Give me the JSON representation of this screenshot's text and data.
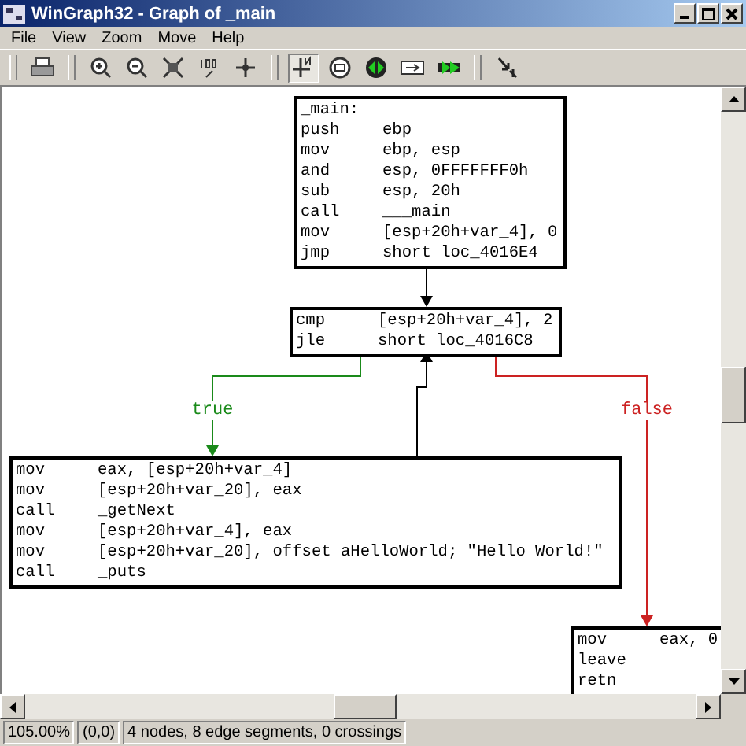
{
  "window": {
    "title": "WinGraph32 - Graph of _main"
  },
  "menu": [
    "File",
    "View",
    "Zoom",
    "Move",
    "Help"
  ],
  "toolbar": [
    {
      "kind": "print"
    },
    {
      "kind": "sep"
    },
    {
      "kind": "zoom-in"
    },
    {
      "kind": "zoom-out"
    },
    {
      "kind": "fit"
    },
    {
      "kind": "hundred"
    },
    {
      "kind": "move"
    },
    {
      "kind": "sep"
    },
    {
      "kind": "north",
      "selected": true
    },
    {
      "kind": "circle"
    },
    {
      "kind": "node-green"
    },
    {
      "kind": "edge"
    },
    {
      "kind": "edge-green"
    },
    {
      "kind": "sep"
    },
    {
      "kind": "pointer"
    }
  ],
  "nodes": [
    {
      "lines": [
        {
          "kind": "label",
          "text": "_main:"
        },
        {
          "kind": "ins",
          "op": "push",
          "args": "ebp"
        },
        {
          "kind": "ins",
          "op": "mov",
          "args": "ebp, esp"
        },
        {
          "kind": "ins",
          "op": "and",
          "args": "esp, 0FFFFFFF0h"
        },
        {
          "kind": "ins",
          "op": "sub",
          "args": "esp, 20h"
        },
        {
          "kind": "ins",
          "op": "call",
          "args": "___main"
        },
        {
          "kind": "ins",
          "op": "mov",
          "args": "[esp+20h+var_4], 0"
        },
        {
          "kind": "ins",
          "op": "jmp",
          "args": "short loc_4016E4"
        }
      ]
    },
    {
      "lines": [
        {
          "kind": "ins",
          "op": "cmp",
          "args": "[esp+20h+var_4], 2"
        },
        {
          "kind": "ins",
          "op": "jle",
          "args": "short loc_4016C8"
        }
      ]
    },
    {
      "lines": [
        {
          "kind": "ins",
          "op": "mov",
          "args": "eax, [esp+20h+var_4]"
        },
        {
          "kind": "ins",
          "op": "mov",
          "args": "[esp+20h+var_20], eax"
        },
        {
          "kind": "ins",
          "op": "call",
          "args": "_getNext"
        },
        {
          "kind": "ins",
          "op": "mov",
          "args": "[esp+20h+var_4], eax"
        },
        {
          "kind": "ins",
          "op": "mov",
          "args": "[esp+20h+var_20], offset aHelloWorld; \"Hello World!\""
        },
        {
          "kind": "ins",
          "op": "call",
          "args": "_puts"
        }
      ]
    },
    {
      "lines": [
        {
          "kind": "ins",
          "op": "mov",
          "args": "eax, 0"
        },
        {
          "kind": "ins",
          "op": "leave"
        },
        {
          "kind": "ins",
          "op": "retn"
        }
      ]
    }
  ],
  "edges": [
    {
      "kind": "normal"
    },
    {
      "kind": "true",
      "label": "true"
    },
    {
      "kind": "normal"
    },
    {
      "kind": "false",
      "label": "false"
    }
  ],
  "status_bar": [
    "105.00%",
    "(0,0)",
    "4 nodes, 8 edge segments, 0 crossings"
  ]
}
